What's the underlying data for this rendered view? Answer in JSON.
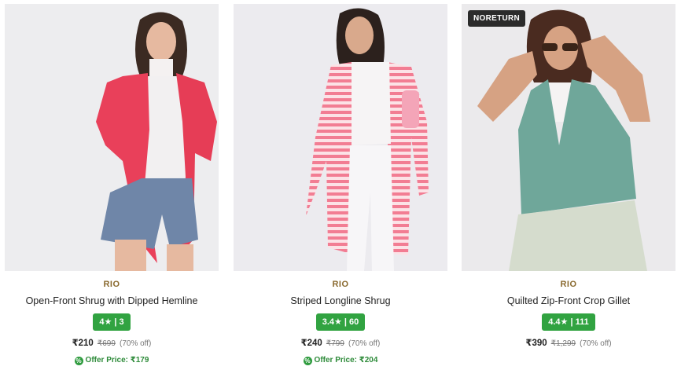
{
  "products": [
    {
      "brand": "RIO",
      "name": "Open-Front Shrug with Dipped Hemline",
      "rating_text": "4★ | 3",
      "price": "₹210",
      "mrp": "₹699",
      "discount": "(70% off)",
      "offer_text": "Offer Price: ₹179",
      "badge": "",
      "image_icon": "model-red-shrug-image"
    },
    {
      "brand": "RIO",
      "name": "Striped Longline Shrug",
      "rating_text": "3.4★ | 60",
      "price": "₹240",
      "mrp": "₹799",
      "discount": "(70% off)",
      "offer_text": "Offer Price: ₹204",
      "badge": "",
      "image_icon": "model-striped-shrug-image"
    },
    {
      "brand": "RIO",
      "name": "Quilted Zip-Front Crop Gillet",
      "rating_text": "4.4★ | 111",
      "price": "₹390",
      "mrp": "₹1,299",
      "discount": "(70% off)",
      "offer_text": "",
      "badge": "NORETURN",
      "image_icon": "model-green-gillet-image"
    }
  ],
  "colors": {
    "brand_text": "#8a6a2f",
    "rating_bg": "#31a341",
    "offer_text": "#2e8b3a",
    "badge_bg": "#2b2b2b"
  }
}
